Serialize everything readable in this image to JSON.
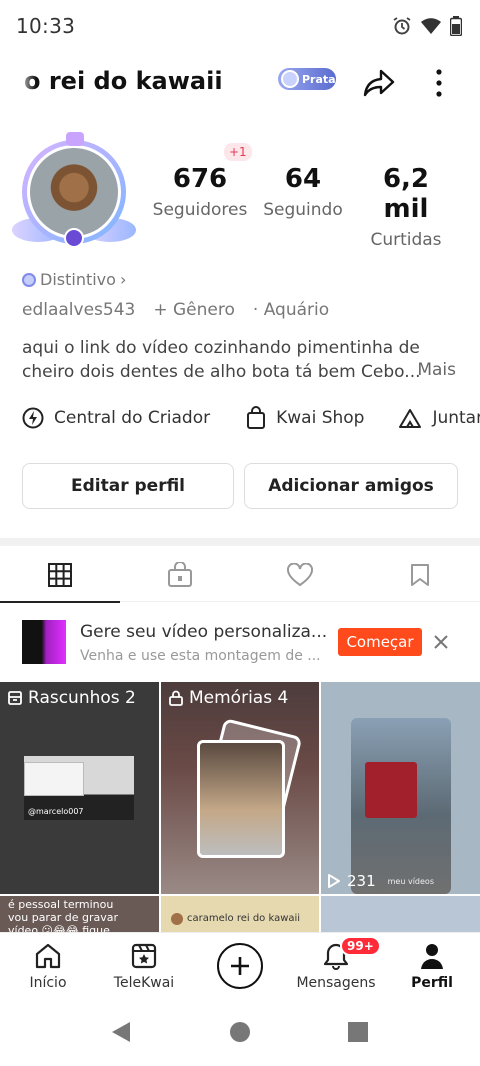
{
  "status_bar": {
    "time": "10:33"
  },
  "header": {
    "username": "o rei do kawaii",
    "badge_label": "Prata"
  },
  "profile": {
    "plus_badge": "+1",
    "stats": [
      {
        "value": "676",
        "label": "Seguidores"
      },
      {
        "value": "64",
        "label": "Seguindo"
      },
      {
        "value": "6,2 mil",
        "label": "Curtidas"
      }
    ],
    "distintivo_label": "Distintivo",
    "handle": "edlaalves543",
    "gender": "+ Gênero",
    "sign": "· Aquário",
    "bio_line1": "aqui o link do vídeo cozinhando pimentinha de",
    "bio_line2": "cheiro dois dentes de alho bota tá bem Cebo...",
    "bio_more": "Mais"
  },
  "shortcuts": {
    "creator_center": "Central do Criador",
    "kwai_shop": "Kwai Shop",
    "join": "Juntar"
  },
  "actions": {
    "edit_profile": "Editar perfil",
    "add_friends": "Adicionar amigos"
  },
  "tabs": [
    "grid",
    "private",
    "liked",
    "saved"
  ],
  "promo": {
    "title": "Gere seu vídeo personaliza...",
    "subtitle": "Venha e use esta montagem de ...",
    "cta": "Começar"
  },
  "grid": {
    "drafts_label": "Rascunhos 2",
    "drafts_caption": "@marcelo007",
    "memories_label": "Memórias 4",
    "views": "231",
    "views_caption": "meu vídeos",
    "cell4_text": "é pessoal terminou vou parar de gravar vídeo 😕😂😂 fique",
    "cell5_text": "caramelo rei do kawaii"
  },
  "bottom_nav": {
    "home": "Início",
    "telekwai": "TeleKwai",
    "messages": "Mensagens",
    "messages_badge": "99+",
    "profile": "Perfil"
  },
  "colors": {
    "accent": "#ff4a1c",
    "badge_red": "#ff2b38",
    "prata_badge": "#5a6ccf"
  }
}
